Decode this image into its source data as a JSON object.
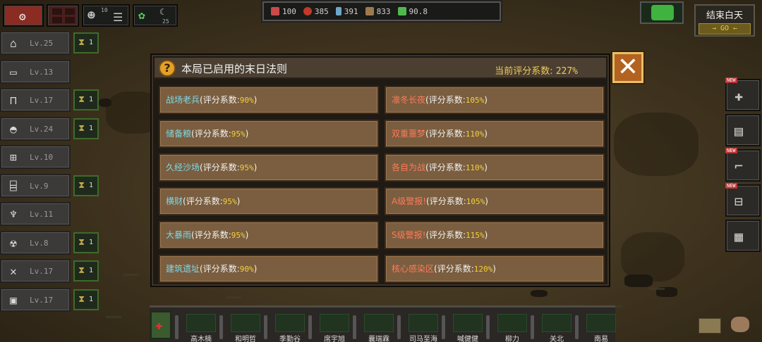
{
  "top_left": {
    "char_count": "10",
    "plant_count": "25"
  },
  "resources": [
    {
      "name": "calendar-icon",
      "value": "100",
      "color": "#c94a4a"
    },
    {
      "name": "meat-icon",
      "value": "385",
      "color": "#c0392b"
    },
    {
      "name": "water-icon",
      "value": "391",
      "color": "#6fa7c9"
    },
    {
      "name": "wood-icon",
      "value": "833",
      "color": "#9c7a4e"
    },
    {
      "name": "energy-icon",
      "value": "90.8",
      "color": "#4fb84f"
    }
  ],
  "end_day": {
    "label": "结束白天",
    "go": "→ GO ←"
  },
  "buildings": [
    {
      "icon": "house-icon",
      "glyph": "⌂",
      "lv": "Lv.25",
      "slot": "1"
    },
    {
      "icon": "bed-icon",
      "glyph": "▭",
      "lv": "Lv.13",
      "slot": ""
    },
    {
      "icon": "table-icon",
      "glyph": "⊓",
      "lv": "Lv.17",
      "slot": "1"
    },
    {
      "icon": "cooking-icon",
      "glyph": "◓",
      "lv": "Lv.24",
      "slot": "1"
    },
    {
      "icon": "medkit-icon",
      "glyph": "⊞",
      "lv": "Lv.10",
      "slot": ""
    },
    {
      "icon": "radio-icon",
      "glyph": "⌸",
      "lv": "Lv.9",
      "slot": "1"
    },
    {
      "icon": "bomb-icon",
      "glyph": "♆",
      "lv": "Lv.11",
      "slot": ""
    },
    {
      "icon": "gasmask-icon",
      "glyph": "☢",
      "lv": "Lv.8",
      "slot": "1"
    },
    {
      "icon": "crossed-tools-icon",
      "glyph": "✕",
      "lv": "Lv.17",
      "slot": "1"
    },
    {
      "icon": "battery-icon",
      "glyph": "▣",
      "lv": "Lv.17",
      "slot": "1"
    }
  ],
  "right_panels": [
    {
      "icon": "first-aid-icon",
      "glyph": "✚",
      "new": "NEW"
    },
    {
      "icon": "drink-icon",
      "glyph": "▤",
      "new": ""
    },
    {
      "icon": "rifle-icon",
      "glyph": "⌐",
      "new": "NEW"
    },
    {
      "icon": "workbench-icon",
      "glyph": "⊟",
      "new": "NEW"
    },
    {
      "icon": "map-icon",
      "glyph": "▦",
      "new": ""
    }
  ],
  "dialog": {
    "title": "本局已启用的末日法则",
    "score_label": "当前评分系数:",
    "score_value": "227%",
    "close": "✕"
  },
  "rules": [
    {
      "name": "战场老兵",
      "color": "blue",
      "coef": "(评分系数:",
      "pct": "90%",
      "close": ")"
    },
    {
      "name": "凛冬长夜",
      "color": "red",
      "coef": "(评分系数:",
      "pct": "105%",
      "close": ")"
    },
    {
      "name": "储备粮",
      "color": "blue",
      "coef": "(评分系数:",
      "pct": "95%",
      "close": ")"
    },
    {
      "name": "双重噩梦",
      "color": "red",
      "coef": "(评分系数:",
      "pct": "110%",
      "close": ")"
    },
    {
      "name": "久经沙场",
      "color": "blue",
      "coef": "(评分系数:",
      "pct": "95%",
      "close": ")"
    },
    {
      "name": "各自为战",
      "color": "red",
      "coef": "(评分系数:",
      "pct": "110%",
      "close": ")"
    },
    {
      "name": "横财",
      "color": "blue",
      "coef": "(评分系数:",
      "pct": "95%",
      "close": ")"
    },
    {
      "name": "A级警报!",
      "color": "red",
      "coef": "(评分系数:",
      "pct": "105%",
      "close": ")"
    },
    {
      "name": "大暴雨",
      "color": "blue",
      "coef": "(评分系数:",
      "pct": "95%",
      "close": ")"
    },
    {
      "name": "S级警报!",
      "color": "red",
      "coef": "(评分系数:",
      "pct": "115%",
      "close": ")"
    },
    {
      "name": "建筑遗址",
      "color": "blue",
      "coef": "(评分系数:",
      "pct": "90%",
      "close": ")"
    },
    {
      "name": "核心感染区",
      "color": "red",
      "coef": "(评分系数:",
      "pct": "120%",
      "close": ")"
    }
  ],
  "survivors": [
    "高木楠",
    "和明哲",
    "季勤谷",
    "席宇旭",
    "曩瑞霖",
    "司马至海",
    "喊健健",
    "柳力",
    "关北",
    "南易"
  ]
}
